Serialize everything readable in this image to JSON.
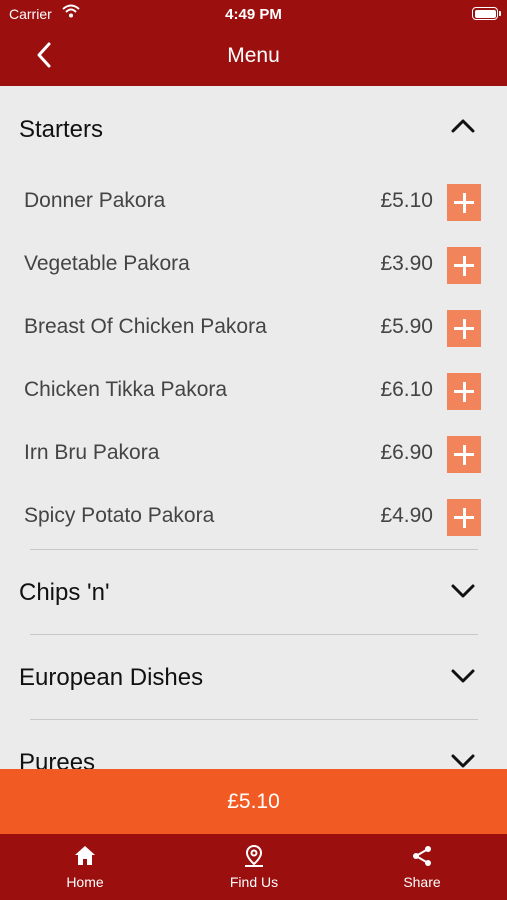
{
  "status_bar": {
    "carrier": "Carrier",
    "time": "4:49 PM"
  },
  "nav": {
    "title": "Menu"
  },
  "sections": {
    "starters": {
      "label": "Starters",
      "expanded": true
    },
    "chips": {
      "label": "Chips 'n'"
    },
    "european": {
      "label": "European Dishes"
    },
    "purees": {
      "label": "Purees"
    }
  },
  "starters_items": [
    {
      "name": "Donner Pakora",
      "price": "£5.10"
    },
    {
      "name": "Vegetable Pakora",
      "price": "£3.90"
    },
    {
      "name": "Breast Of Chicken Pakora",
      "price": "£5.90"
    },
    {
      "name": "Chicken Tikka Pakora",
      "price": "£6.10"
    },
    {
      "name": "Irn Bru Pakora",
      "price": "£6.90"
    },
    {
      "name": "Spicy Potato Pakora",
      "price": "£4.90"
    }
  ],
  "checkout": {
    "total": "£5.10"
  },
  "tabs": [
    {
      "label": "Home",
      "icon": "home-icon"
    },
    {
      "label": "Find Us",
      "icon": "location-pin-icon"
    },
    {
      "label": "Share",
      "icon": "share-icon"
    }
  ],
  "colors": {
    "brand_red": "#9b0f0f",
    "accent_orange": "#f25a23",
    "add_button": "#f2845c",
    "background": "#ebebeb"
  }
}
